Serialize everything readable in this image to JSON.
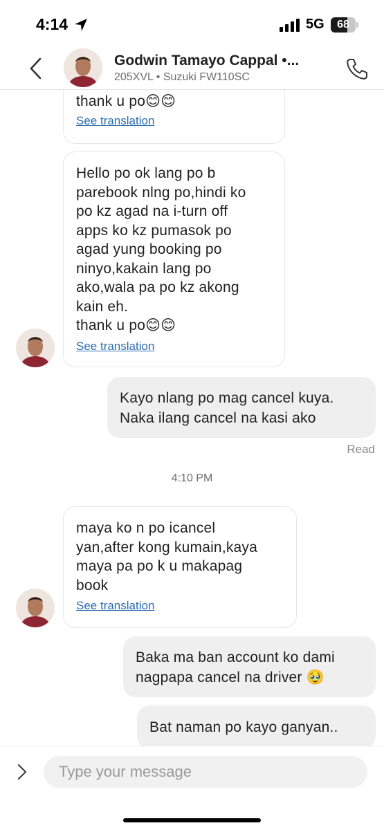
{
  "status_bar": {
    "time": "4:14",
    "network": "5G",
    "battery_level": "68",
    "battery_fraction": 0.68
  },
  "header": {
    "contact_name": "Godwin Tamayo Cappal •...",
    "vehicle_info": "205XVL • Suzuki FW110SC"
  },
  "messages": [
    {
      "direction": "incoming",
      "text": "thank u po😊😊",
      "action": "See translation"
    },
    {
      "direction": "incoming",
      "text": "Hello po ok lang po b\nparebook nlng po,hindi ko\npo kz agad na i-turn off\napps ko kz pumasok po\nagad yung booking po\nninyo,kakain lang po\nako,wala pa po kz akong\nkain eh.\nthank u po😊😊",
      "action": "See translation"
    },
    {
      "direction": "outgoing",
      "text": "Kayo nlang po mag cancel kuya.\nNaka ilang cancel na kasi ako"
    },
    {
      "direction": "incoming",
      "text": "maya ko n po icancel\nyan,after kong kumain,kaya\nmaya pa po k u makapag\nbook",
      "action": "See translation"
    },
    {
      "direction": "outgoing",
      "text": "Baka ma ban account ko dami\nnagpapa cancel na driver 🥹"
    },
    {
      "direction": "outgoing",
      "text": "Bat naman po kayo ganyan.."
    }
  ],
  "read_receipt": "Read",
  "timestamp": "4:10 PM",
  "composer": {
    "placeholder": "Type your message"
  },
  "colors": {
    "outgoing_bubble": "#efefef",
    "incoming_border": "#e6e6e6",
    "link": "#2b6cb0"
  },
  "icons": [
    "location-arrow-icon",
    "signal-bars-icon",
    "battery-icon",
    "back-chevron-icon",
    "phone-icon",
    "expand-chevron-icon"
  ]
}
